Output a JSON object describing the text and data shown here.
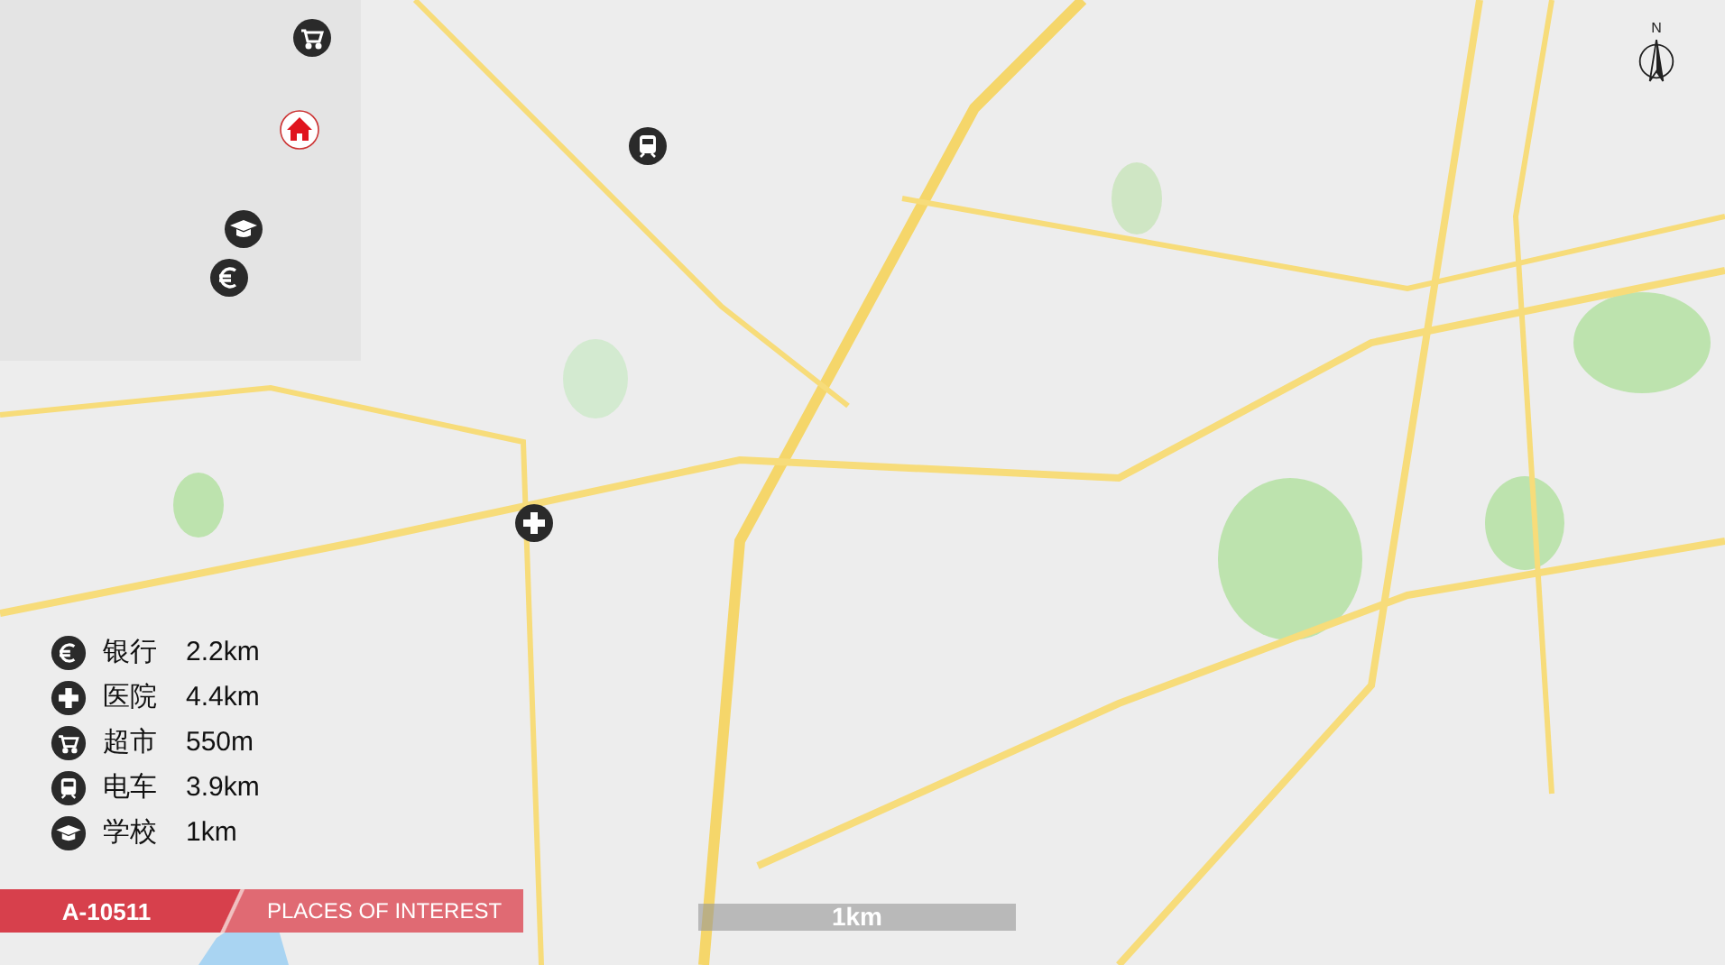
{
  "map_markers": [
    {
      "kind": "shop"
    },
    {
      "kind": "home"
    },
    {
      "kind": "train"
    },
    {
      "kind": "school"
    },
    {
      "kind": "bank"
    },
    {
      "kind": "hospital"
    }
  ],
  "legend": [
    {
      "kind": "bank",
      "label": "银行",
      "distance": "2.2km"
    },
    {
      "kind": "hospital",
      "label": "医院",
      "distance": "4.4km"
    },
    {
      "kind": "shop",
      "label": "超市",
      "distance": "550m"
    },
    {
      "kind": "train",
      "label": "电车",
      "distance": "3.9km"
    },
    {
      "kind": "school",
      "label": "学校",
      "distance": "1km"
    }
  ],
  "footer": {
    "code": "A-10511",
    "title": "PLACES OF INTEREST"
  },
  "scale_bar": {
    "label": "1km"
  },
  "compass": {
    "label": "N"
  }
}
